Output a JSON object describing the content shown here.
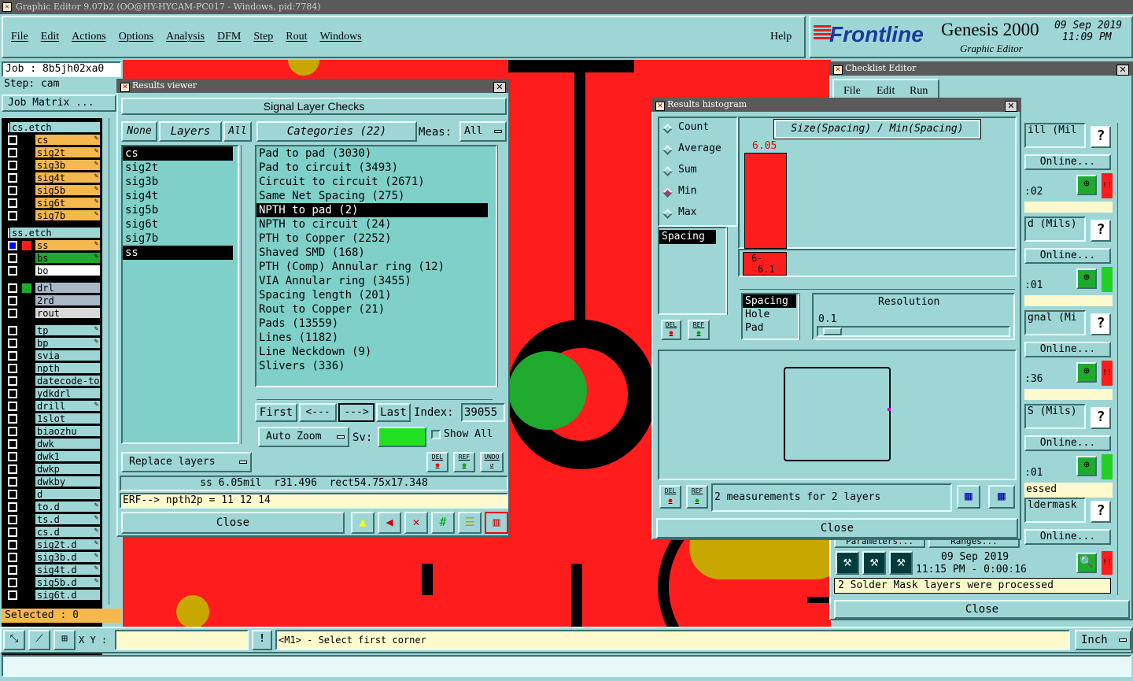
{
  "title_bar": "Graphic Editor 9.07b2 (OO@HY-HYCAM-PC017 - Windows, pid:7784)",
  "menu": [
    "File",
    "Edit",
    "Actions",
    "Options",
    "Analysis",
    "DFM",
    "Step",
    "Rout",
    "Windows"
  ],
  "help": "Help",
  "brand": {
    "logo": "Frontline",
    "product": "Genesis 2000",
    "sub": "Graphic Editor",
    "date": "09 Sep 2019",
    "time": "11:09 PM"
  },
  "job": {
    "label": "Job : 8b5jh02xa0",
    "step": "Step: cam",
    "matrix": "Job Matrix ...",
    "selected": "Selected : 0"
  },
  "layers": [
    "cs.etch",
    "cs",
    "sig2t",
    "sig3b",
    "sig4t",
    "sig5b",
    "sig6t",
    "sig7b",
    "ss.etch",
    "ss",
    "bs",
    "bo",
    "drl",
    "2rd",
    "rout",
    "tp",
    "bp",
    "svia",
    "npth",
    "datecode-to",
    "ydkdrl",
    "drill",
    "1slot",
    "biaozhu",
    "dwk",
    "dwk1",
    "dwkp",
    "dwkby",
    "d",
    "to.d",
    "ts.d",
    "cs.d",
    "sig2t.d",
    "sig3b.d",
    "sig4t.d",
    "sig5b.d",
    "sig6t.d"
  ],
  "results_viewer": {
    "title": "Results viewer",
    "header": "Signal Layer Checks",
    "none": "None",
    "layers_btn": "Layers",
    "all_btn": "All",
    "categories_btn": "Categories (22)",
    "meas_label": "Meas:",
    "meas_value": "All",
    "layer_list": [
      "cs",
      "sig2t",
      "sig3b",
      "sig4t",
      "sig5b",
      "sig6t",
      "sig7b",
      "ss"
    ],
    "categories": [
      "Pad to pad (3030)",
      "Pad to circuit (3493)",
      "Circuit to circuit (2671)",
      "Same Net Spacing (275)",
      "NPTH to pad (2)",
      "NPTH to circuit (24)",
      "PTH to Copper (2252)",
      "Shaved SMD (168)",
      "PTH (Comp) Annular ring (12)",
      "VIA Annular ring (3455)",
      "Spacing length (201)",
      "Rout to Copper (21)",
      "Pads (13559)",
      "Lines (1182)",
      "Line Neckdown (9)",
      "Slivers (336)"
    ],
    "first": "First",
    "prev": "<---",
    "next": "--->",
    "last": "Last",
    "index_label": "Index:",
    "index_value": "39055",
    "auto_zoom": "Auto Zoom",
    "sv": "Sv:",
    "show_all": "Show All",
    "replace": "Replace layers",
    "del": "DEL",
    "ref": "REF",
    "undo": "UNDO",
    "status": "ss 6.05mil  r31.496  rect54.75x17.348",
    "erf": "ERF--> npth2p = 11 12 14",
    "close": "Close"
  },
  "histogram": {
    "title": "Results histogram",
    "modes": [
      "Count",
      "Average",
      "Sum",
      "Min",
      "Max"
    ],
    "selected_mode": "Min",
    "chart_title": "Size(Spacing) / Min(Spacing)",
    "bar_value": "6.05",
    "bin_label_1": "6-",
    "bin_label_2": "6.1",
    "list1": [
      "Spacing"
    ],
    "list2": [
      "Spacing",
      "Hole",
      "Pad"
    ],
    "resolution_label": "Resolution",
    "resolution_value": "0.1",
    "msg": "2 measurements for 2 layers",
    "close": "Close",
    "del": "DEL",
    "ref": "REF"
  },
  "checklist": {
    "title": "Checklist Editor",
    "menu": [
      "File",
      "Edit",
      "Run"
    ],
    "rows": [
      {
        "name": "ill (Mil",
        "online": "Online...",
        "time": ":02",
        "status": "red"
      },
      {
        "name": "d (Mils)",
        "online": "Online...",
        "time": ":01",
        "status": "green"
      },
      {
        "name": "gnal (Mi",
        "online": "Online...",
        "time": ":36",
        "status": "red"
      },
      {
        "name": "S (Mils)",
        "online": "Online...",
        "time": ":01",
        "status": "green"
      },
      {
        "name": "ldermask",
        "online": "Online...",
        "time": "",
        "status": "red"
      }
    ],
    "processed": "essed",
    "param": "Parameters...",
    "ranges": "Ranges...",
    "date": "09 Sep 2019",
    "time": "11:15 PM - 0:00:16",
    "result": "2 Solder Mask layers were processed",
    "close": "Close"
  },
  "bottom": {
    "xy": "X Y :",
    "prompt": "<M1> - Select first corner",
    "unit": "Inch"
  },
  "colors": {
    "bg": "#9ed6d6",
    "board_red": "#ff1c1c",
    "copper_green": "#1faa2e",
    "pad_gold": "#c8a800",
    "cs": "#f5b84e"
  }
}
